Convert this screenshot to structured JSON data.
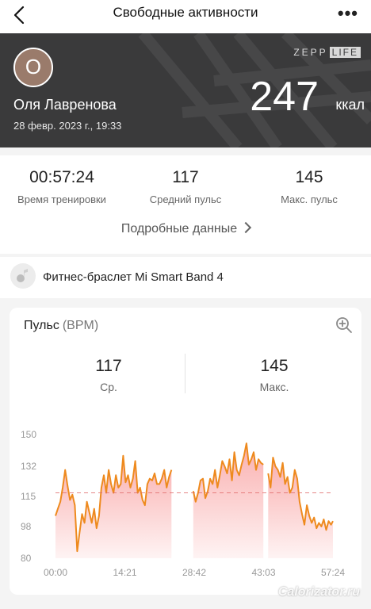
{
  "topbar": {
    "title": "Свободные активности",
    "more": "•••"
  },
  "header": {
    "avatar_letter": "О",
    "user_name": "Оля Лавренова",
    "date": "28 февр. 2023 г., 19:33",
    "brand_left": "ZEPP",
    "brand_right": "LIFE",
    "calories": "247",
    "calories_unit": "ккал"
  },
  "summary": {
    "stats": [
      {
        "value": "00:57:24",
        "label": "Время тренировки"
      },
      {
        "value": "117",
        "label": "Средний пульс"
      },
      {
        "value": "145",
        "label": "Макс. пульс"
      }
    ],
    "details_link": "Подробные данные"
  },
  "device": {
    "name": "Фитнес-браслет Mi Smart Band 4"
  },
  "heart_card": {
    "title": "Пульс",
    "unit": "(BPM)",
    "avg_value": "117",
    "avg_label": "Ср.",
    "max_value": "145",
    "max_label": "Макс."
  },
  "chart_data": {
    "type": "area",
    "series": [
      {
        "x": [
          0.0,
          0.5,
          1.0,
          1.5,
          2.0,
          2.5,
          3.0,
          3.5,
          4.0,
          4.5,
          5.0,
          5.5,
          6.0,
          6.5,
          7.0,
          7.5,
          8.0,
          8.5,
          9.0,
          9.5,
          10.0,
          10.5,
          11.0,
          11.5,
          12.0,
          12.5,
          13.0,
          13.5,
          14.0,
          14.5,
          15.0,
          15.5,
          16.0,
          16.5,
          17.0,
          17.5,
          18.0,
          18.5,
          19.0,
          19.5,
          20.0,
          20.5,
          21.0,
          21.5,
          22.0,
          22.5,
          23.0,
          23.5,
          24.0
        ],
        "y": [
          104,
          108,
          112,
          120,
          130,
          121,
          113,
          116,
          110,
          84,
          95,
          105,
          100,
          112,
          106,
          100,
          108,
          97,
          104,
          120,
          127,
          117,
          130,
          122,
          117,
          127,
          120,
          122,
          138,
          123,
          127,
          120,
          125,
          135,
          117,
          120,
          113,
          110,
          122,
          125,
          124,
          128,
          122,
          122,
          125,
          130,
          120,
          126,
          130
        ],
        "segment": 1
      },
      {
        "x": [
          28.5,
          29.0,
          29.5,
          30.0,
          30.5,
          31.0,
          31.5,
          32.0,
          32.5,
          33.0,
          33.5,
          34.0,
          34.5,
          35.0,
          35.5,
          36.0,
          36.5,
          37.0,
          37.5,
          38.0,
          38.5,
          39.0,
          39.5,
          40.0,
          40.5,
          41.0,
          41.5,
          42.0,
          42.5,
          43.0
        ],
        "y": [
          118,
          112,
          117,
          124,
          125,
          114,
          118,
          125,
          122,
          130,
          120,
          127,
          135,
          132,
          128,
          136,
          124,
          140,
          130,
          127,
          133,
          138,
          145,
          133,
          136,
          140,
          130,
          136,
          134,
          133
        ],
        "segment": 2
      },
      {
        "x": [
          44.0,
          44.5,
          45.0,
          45.5,
          46.0,
          46.5,
          47.0,
          47.5,
          48.0,
          48.5,
          49.0,
          49.5,
          50.0,
          50.5,
          51.0,
          51.5,
          52.0,
          52.5,
          53.0,
          53.5,
          54.0,
          54.5,
          55.0,
          55.5,
          56.0,
          56.5,
          57.0,
          57.4
        ],
        "y": [
          128,
          120,
          137,
          132,
          130,
          126,
          134,
          122,
          126,
          117,
          120,
          130,
          125,
          112,
          105,
          99,
          110,
          104,
          100,
          103,
          97,
          100,
          98,
          102,
          96,
          101,
          99,
          101
        ],
        "segment": 3
      }
    ],
    "avg_line": 117,
    "ylim": [
      80,
      150
    ],
    "xlim": [
      0,
      57.4
    ],
    "y_ticks": [
      "150",
      "132",
      "115",
      "98",
      "80"
    ],
    "x_ticks": [
      "00:00",
      "14:21",
      "28:42",
      "43:03",
      "57:24"
    ],
    "line_color": "#ee8a1e",
    "fill_color": "#f56e6e"
  },
  "watermark": "Calorizator.ru"
}
